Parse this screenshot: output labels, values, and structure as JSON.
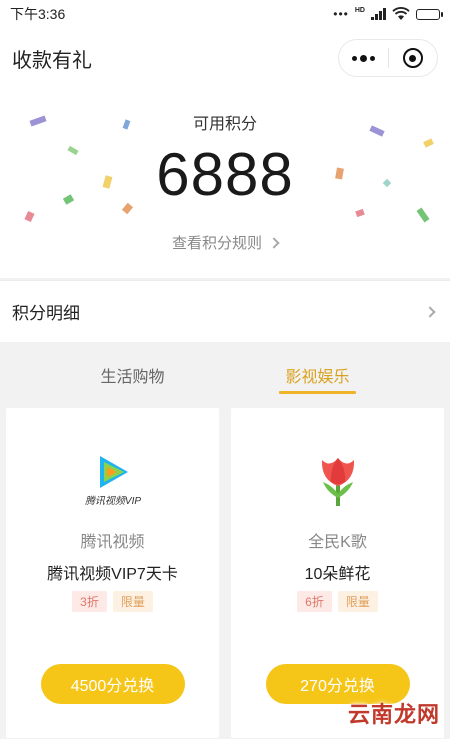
{
  "status_bar": {
    "time": "下午3:36",
    "signal_label": "HD"
  },
  "nav": {
    "title": "收款有礼"
  },
  "points": {
    "label": "可用积分",
    "value": "6888",
    "rule_link": "查看积分规则"
  },
  "detail": {
    "label": "积分明细"
  },
  "tabs": [
    {
      "label": "生活购物",
      "active": false
    },
    {
      "label": "影视娱乐",
      "active": true
    }
  ],
  "cards": [
    {
      "icon": "tencent-video-vip-logo",
      "logo_text": "腾讯视频VIP",
      "brand": "腾讯视频",
      "name": "腾讯视频VIP7天卡",
      "discount_tag": "3折",
      "limit_tag": "限量",
      "button": "4500分兑换"
    },
    {
      "icon": "tulip-flower-icon",
      "brand": "全民K歌",
      "name": "10朵鲜花",
      "discount_tag": "6折",
      "limit_tag": "限量",
      "button": "270分兑换"
    }
  ],
  "watermark": {
    "text": "云南龙网"
  },
  "colors": {
    "accent": "#f5c518",
    "active_tab": "#d9a321",
    "discount_tag": "#e0786a",
    "limit_tag": "#e09f5a"
  }
}
